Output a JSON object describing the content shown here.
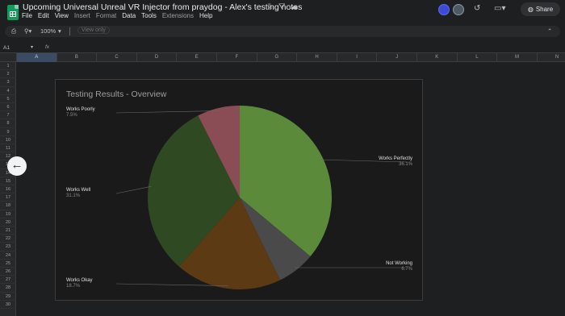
{
  "title_bar": {
    "doc_title": "Upcoming Universal Unreal VR Injector from praydog - Alex's testing notes",
    "icons": [
      "star-icon",
      "drive-icon",
      "cloud-icon"
    ]
  },
  "menu": [
    "File",
    "Edit",
    "View",
    "Insert",
    "Format",
    "Data",
    "Tools",
    "Extensions",
    "Help"
  ],
  "right_controls": {
    "share_label": "Share"
  },
  "toolbar": {
    "zoom": "100%",
    "view_only": "View only"
  },
  "formula_bar": {
    "cell_ref": "A1",
    "fx": "fx"
  },
  "columns": [
    "A",
    "B",
    "C",
    "D",
    "E",
    "F",
    "G",
    "H",
    "I",
    "J",
    "K",
    "L",
    "M",
    "N"
  ],
  "rows": [
    "1",
    "2",
    "3",
    "4",
    "5",
    "6",
    "7",
    "8",
    "9",
    "10",
    "11",
    "12",
    "13",
    "14",
    "15",
    "16",
    "17",
    "18",
    "19",
    "20",
    "21",
    "22",
    "23",
    "24",
    "25",
    "26",
    "27",
    "28",
    "29",
    "30"
  ],
  "chart_data": {
    "type": "pie",
    "title": "Testing Results - Overview",
    "slices": [
      {
        "label": "Works Perfectly",
        "value": 36.1,
        "pct_label": "36.1%",
        "color": "#5a8a3a"
      },
      {
        "label": "Not Working",
        "value": 6.7,
        "pct_label": "6.7%",
        "color": "#4a4a4a"
      },
      {
        "label": "Works Okay",
        "value": 18.7,
        "pct_label": "18.7%",
        "color": "#5c3a14"
      },
      {
        "label": "Works Well",
        "value": 31.1,
        "pct_label": "31.1%",
        "color": "#2f4a22"
      },
      {
        "label": "Works Poorly",
        "value": 7.5,
        "pct_label": "7.5%",
        "color": "#8a4c55"
      }
    ]
  }
}
